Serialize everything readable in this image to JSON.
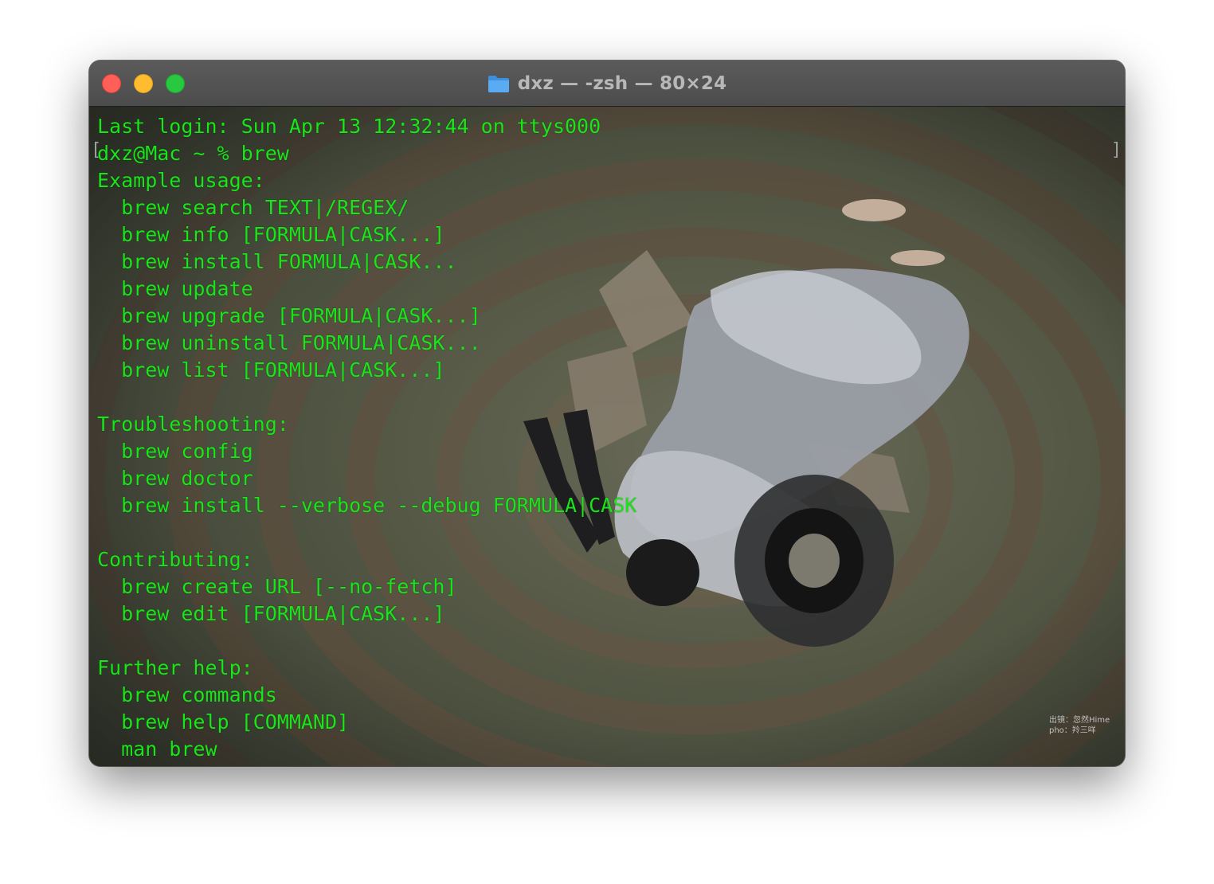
{
  "window": {
    "title": "dxz — -zsh — 80×24",
    "folder_icon": "folder-icon"
  },
  "terminal": {
    "lines": [
      "Last login: Sun Apr 13 12:32:44 on ttys000",
      "dxz@Mac ~ % brew",
      "Example usage:",
      "  brew search TEXT|/REGEX/",
      "  brew info [FORMULA|CASK...]",
      "  brew install FORMULA|CASK...",
      "  brew update",
      "  brew upgrade [FORMULA|CASK...]",
      "  brew uninstall FORMULA|CASK...",
      "  brew list [FORMULA|CASK...]",
      "",
      "Troubleshooting:",
      "  brew config",
      "  brew doctor",
      "  brew install --verbose --debug FORMULA|CASK",
      "",
      "Contributing:",
      "  brew create URL [--no-fetch]",
      "  brew edit [FORMULA|CASK...]",
      "",
      "Further help:",
      "  brew commands",
      "  brew help [COMMAND]",
      "  man brew"
    ],
    "text_color": "#19e619"
  },
  "background": {
    "watermark_line1": "出镜：忽然Hime",
    "watermark_line2": "pho：羚三咩"
  },
  "traffic_lights": {
    "close_color": "#ff5f57",
    "minimize_color": "#febc2e",
    "zoom_color": "#28c840"
  }
}
